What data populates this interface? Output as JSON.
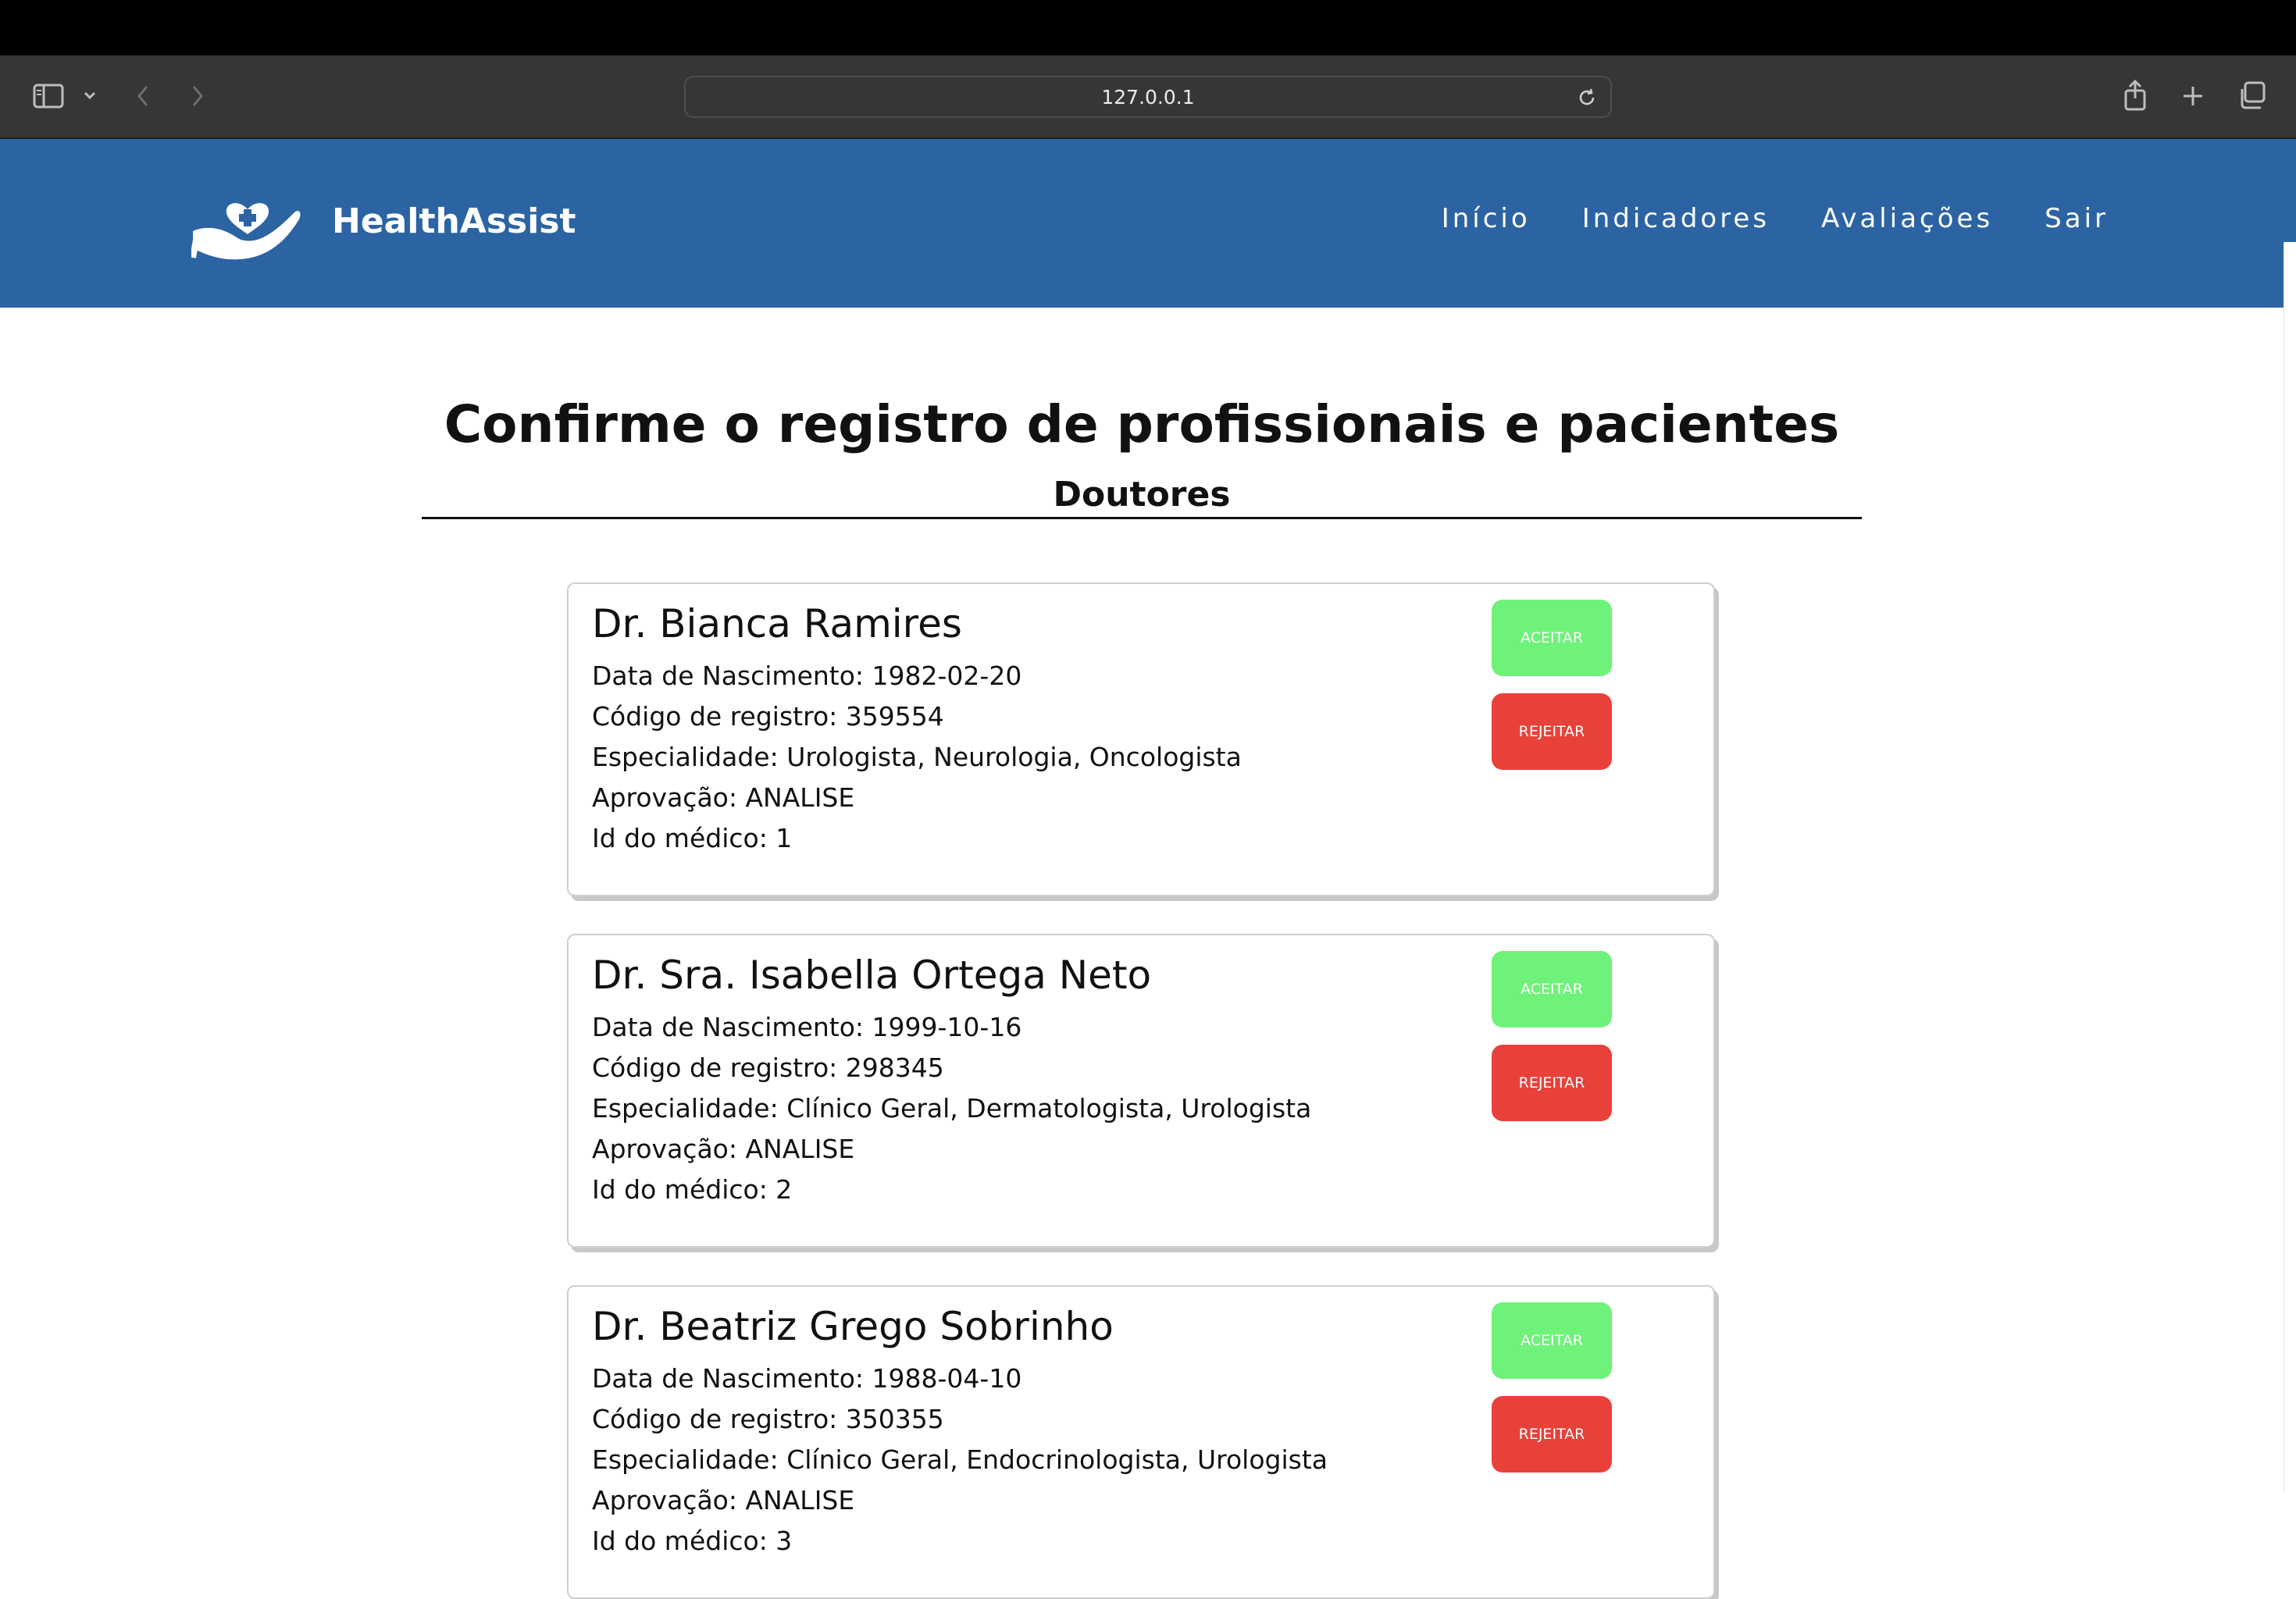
{
  "browser": {
    "url": "127.0.0.1"
  },
  "brand": {
    "name": "HealthAssist",
    "nav_color": "#2c64a3"
  },
  "nav": {
    "items": [
      "Início",
      "Indicadores",
      "Avaliações",
      "Sair"
    ]
  },
  "page": {
    "title": "Confirme o registro de profissionais e pacientes",
    "section": "Doutores"
  },
  "buttons": {
    "accept": "ACEITAR",
    "reject": "REJEITAR",
    "accept_color": "#6ff27a",
    "reject_color": "#e8413a"
  },
  "doctors": [
    {
      "name": "Dr. Bianca Ramires",
      "birth": "Data de Nascimento: 1982-02-20",
      "code": "Código de registro: 359554",
      "specialty": "Especialidade: Urologista, Neurologia, Oncologista",
      "approval": "Aprovação: ANALISE",
      "id": "Id do médico: 1"
    },
    {
      "name": "Dr. Sra. Isabella Ortega Neto",
      "birth": "Data de Nascimento: 1999-10-16",
      "code": "Código de registro: 298345",
      "specialty": "Especialidade: Clínico Geral, Dermatologista, Urologista",
      "approval": "Aprovação: ANALISE",
      "id": "Id do médico: 2"
    },
    {
      "name": "Dr. Beatriz Grego Sobrinho",
      "birth": "Data de Nascimento: 1988-04-10",
      "code": "Código de registro: 350355",
      "specialty": "Especialidade: Clínico Geral, Endocrinologista, Urologista",
      "approval": "Aprovação: ANALISE",
      "id": "Id do médico: 3"
    }
  ]
}
